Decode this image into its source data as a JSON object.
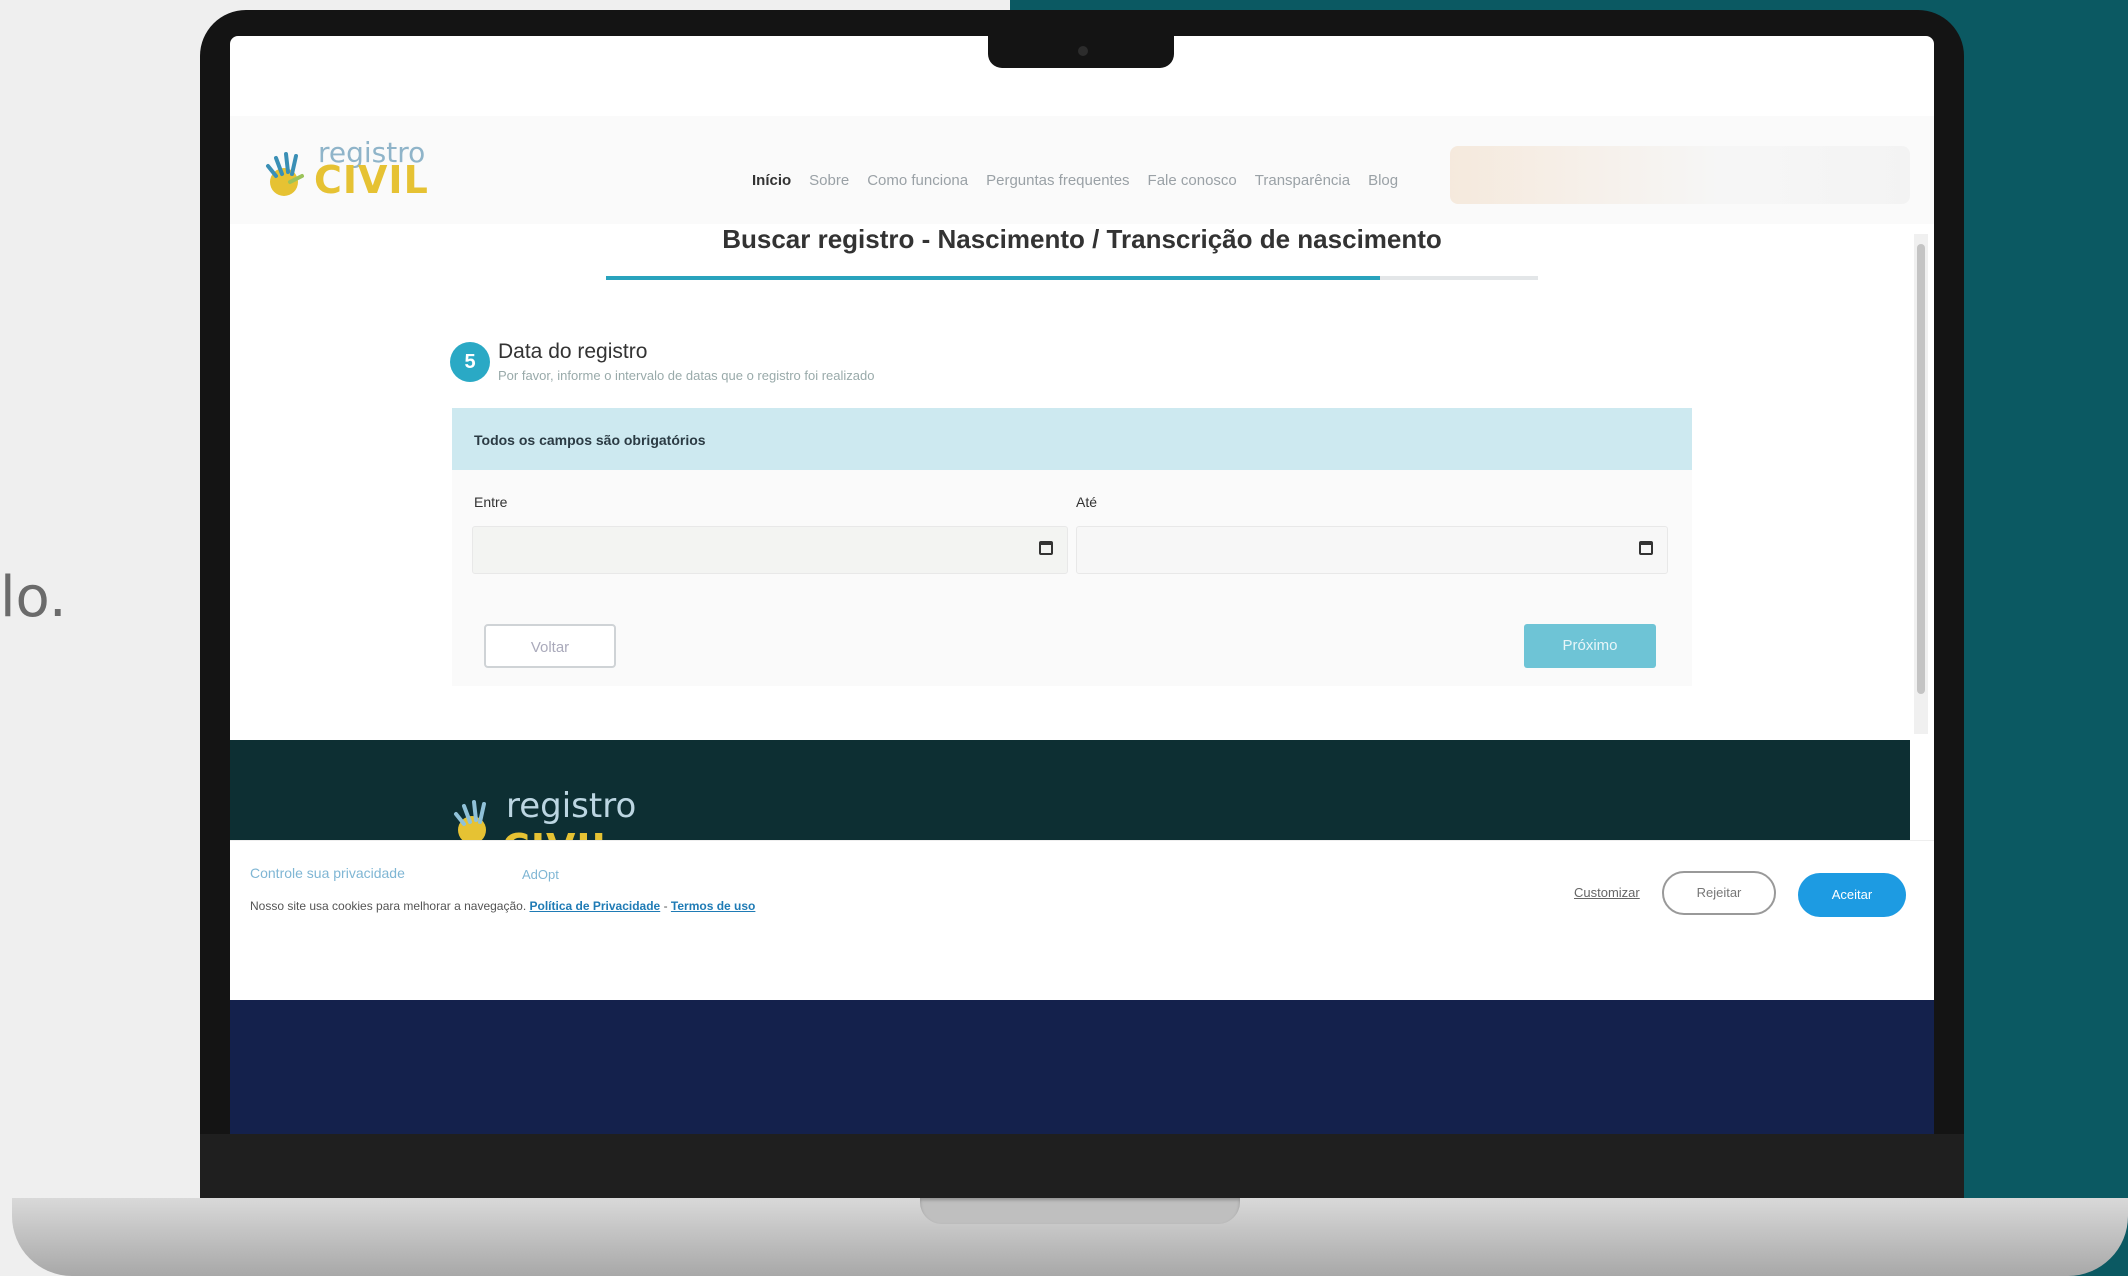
{
  "side_text": "lo.",
  "header": {
    "logo_small": "registro",
    "logo_big": "CIVIL",
    "nav": [
      "Início",
      "Sobre",
      "Como funciona",
      "Perguntas frequentes",
      "Fale conosco",
      "Transparência",
      "Blog"
    ]
  },
  "main": {
    "title": "Buscar registro - Nascimento / Transcrição de nascimento",
    "progress": 0.83,
    "step": {
      "number": "5",
      "title": "Data do registro",
      "subtitle": "Por favor, informe o intervalo de datas que o registro foi realizado"
    },
    "notice": "Todos os campos são obrigatórios",
    "fields": {
      "from_label": "Entre",
      "to_label": "Até"
    },
    "back_label": "Voltar",
    "next_label": "Próximo"
  },
  "footer": {
    "logo_small": "registro",
    "logo_big": "CIVIL"
  },
  "cookie": {
    "title": "Controle sua privacidade",
    "adopt": "AdOpt",
    "text": "Nosso site usa cookies para melhorar a navegação.",
    "privacy_link": "Política de Privacidade",
    "separator": "-",
    "terms_link": "Termos de uso",
    "customize": "Customizar",
    "reject": "Rejeitar",
    "accept": "Aceitar"
  },
  "colors": {
    "accent": "#29a3bd",
    "teal_bg": "#0b5962",
    "footer": "#0d2f33",
    "accept": "#1d9be2"
  }
}
